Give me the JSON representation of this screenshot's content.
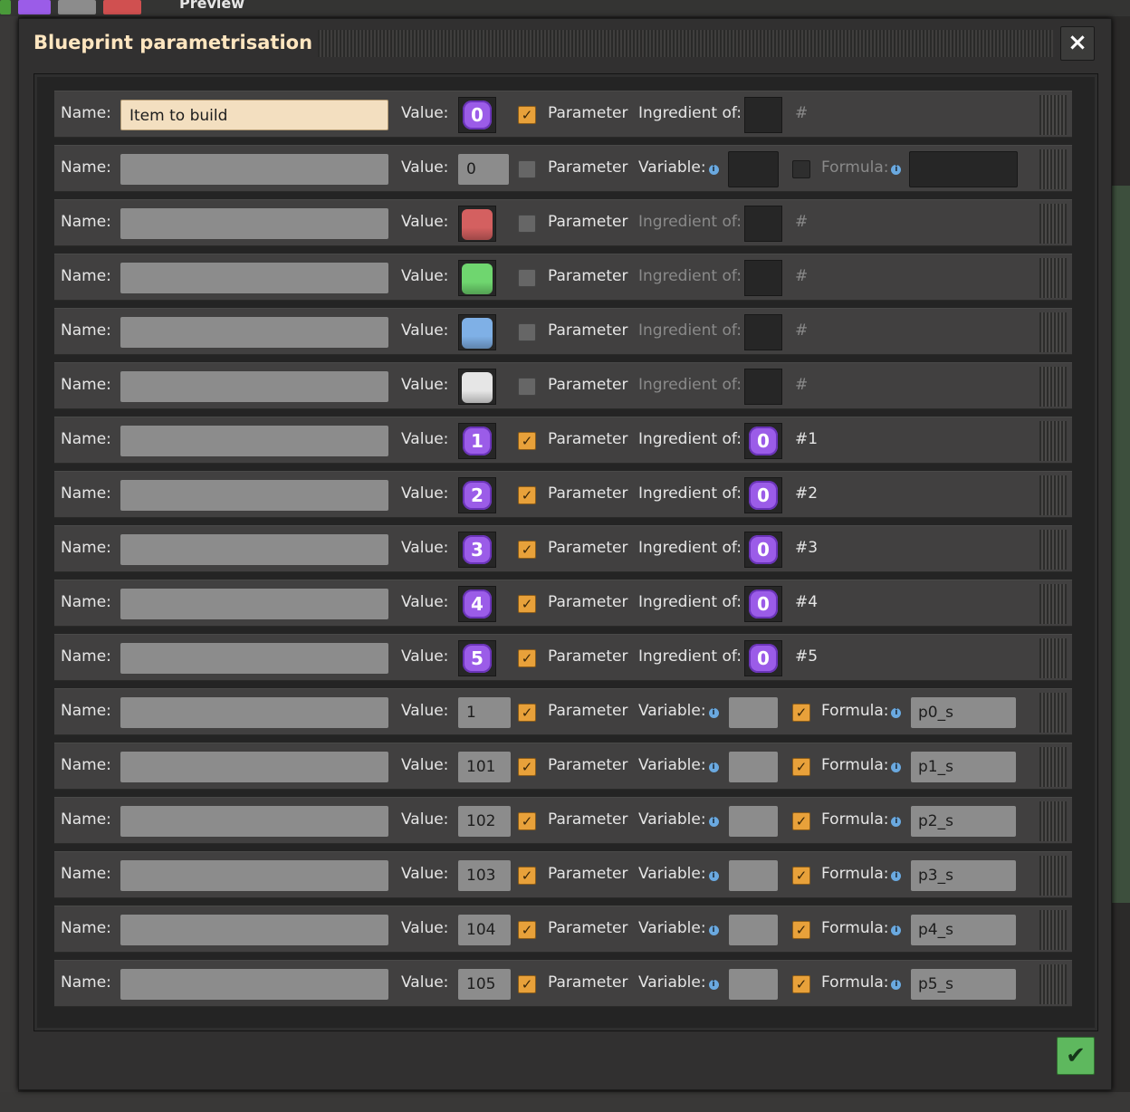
{
  "background": {
    "preview_label": "Preview"
  },
  "dialog": {
    "title": "Blueprint parametrisation",
    "close_label": "×",
    "confirm_label": "✔"
  },
  "labels": {
    "name": "Name:",
    "value": "Value:",
    "parameter": "Parameter",
    "ingredient_of": "Ingredient of:",
    "variable": "Variable:",
    "formula": "Formula:",
    "info": "i"
  },
  "colors": {
    "signal_purple": "#9b5ce8",
    "red": "#d46060",
    "green": "#6fd66f",
    "blue": "#7fb0e6",
    "white": "#e6e6e6",
    "check_orange": "#e8a13a",
    "confirm_green": "#5eb85e"
  },
  "rows": [
    {
      "kind": "ingredient",
      "name": "Item to build",
      "name_active": true,
      "value_type": "signal",
      "value": "0",
      "parameter": true,
      "ingredient_enabled": true,
      "ingredient_signal": "",
      "hash": "#"
    },
    {
      "kind": "variable",
      "name": "",
      "value": "0",
      "value_dim": true,
      "parameter": false,
      "variable_dark": true,
      "formula": false,
      "formula_dim": true,
      "formula_value": ""
    },
    {
      "kind": "ingredient",
      "name": "",
      "value_type": "swatch",
      "swatch": "red",
      "parameter": false,
      "ingredient_enabled": false,
      "ingredient_signal": "",
      "hash": "#"
    },
    {
      "kind": "ingredient",
      "name": "",
      "value_type": "swatch",
      "swatch": "green",
      "parameter": false,
      "ingredient_enabled": false,
      "ingredient_signal": "",
      "hash": "#"
    },
    {
      "kind": "ingredient",
      "name": "",
      "value_type": "swatch",
      "swatch": "blue",
      "parameter": false,
      "ingredient_enabled": false,
      "ingredient_signal": "",
      "hash": "#"
    },
    {
      "kind": "ingredient",
      "name": "",
      "value_type": "swatch",
      "swatch": "white",
      "parameter": false,
      "ingredient_enabled": false,
      "ingredient_signal": "",
      "hash": "#"
    },
    {
      "kind": "ingredient",
      "name": "",
      "value_type": "signal",
      "value": "1",
      "parameter": true,
      "ingredient_enabled": true,
      "ingredient_signal": "0",
      "hash": "#1"
    },
    {
      "kind": "ingredient",
      "name": "",
      "value_type": "signal",
      "value": "2",
      "parameter": true,
      "ingredient_enabled": true,
      "ingredient_signal": "0",
      "hash": "#2"
    },
    {
      "kind": "ingredient",
      "name": "",
      "value_type": "signal",
      "value": "3",
      "parameter": true,
      "ingredient_enabled": true,
      "ingredient_signal": "0",
      "hash": "#3"
    },
    {
      "kind": "ingredient",
      "name": "",
      "value_type": "signal",
      "value": "4",
      "parameter": true,
      "ingredient_enabled": true,
      "ingredient_signal": "0",
      "hash": "#4"
    },
    {
      "kind": "ingredient",
      "name": "",
      "value_type": "signal",
      "value": "5",
      "parameter": true,
      "ingredient_enabled": true,
      "ingredient_signal": "0",
      "hash": "#5"
    },
    {
      "kind": "variable",
      "name": "",
      "value": "1",
      "parameter": true,
      "variable_dark": false,
      "formula": true,
      "formula_value": "p0_s"
    },
    {
      "kind": "variable",
      "name": "",
      "value": "101",
      "parameter": true,
      "variable_dark": false,
      "formula": true,
      "formula_value": "p1_s"
    },
    {
      "kind": "variable",
      "name": "",
      "value": "102",
      "parameter": true,
      "variable_dark": false,
      "formula": true,
      "formula_value": "p2_s"
    },
    {
      "kind": "variable",
      "name": "",
      "value": "103",
      "parameter": true,
      "variable_dark": false,
      "formula": true,
      "formula_value": "p3_s"
    },
    {
      "kind": "variable",
      "name": "",
      "value": "104",
      "parameter": true,
      "variable_dark": false,
      "formula": true,
      "formula_value": "p4_s"
    },
    {
      "kind": "variable",
      "name": "",
      "value": "105",
      "parameter": true,
      "variable_dark": false,
      "formula": true,
      "formula_value": "p5_s"
    }
  ]
}
